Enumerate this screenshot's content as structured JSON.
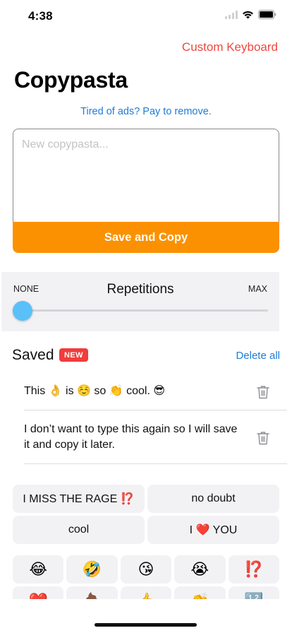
{
  "status": {
    "time": "4:38"
  },
  "header": {
    "keyboard_link": "Custom Keyboard",
    "title": "Copypasta",
    "ads_link": "Tired of ads? Pay to remove."
  },
  "compose": {
    "placeholder": "New copypasta...",
    "save_label": "Save and Copy"
  },
  "repetitions": {
    "title": "Repetitions",
    "min_label": "NONE",
    "max_label": "MAX",
    "value": 0
  },
  "saved": {
    "title": "Saved",
    "badge": "NEW",
    "delete_all": "Delete all",
    "items": [
      {
        "text": "This 👌 is ☺️ so 👏 cool. 😎"
      },
      {
        "text": "I don’t want to type this again so I will save it and copy it later."
      }
    ]
  },
  "quick_phrases": [
    "I MISS THE RAGE ⁉️",
    "no doubt",
    "cool",
    "I ❤️ YOU"
  ],
  "emojis": [
    "😂",
    "🤣",
    "😘",
    "😭",
    "⁉️",
    "❤️",
    "💩",
    "👍",
    "👏",
    "🔢"
  ],
  "colors": {
    "accent_red": "#f2463f",
    "link_blue": "#1f7bd6",
    "save_orange": "#fb9100",
    "slider_blue": "#5ac0f8",
    "badge_red": "#f13c3c"
  }
}
